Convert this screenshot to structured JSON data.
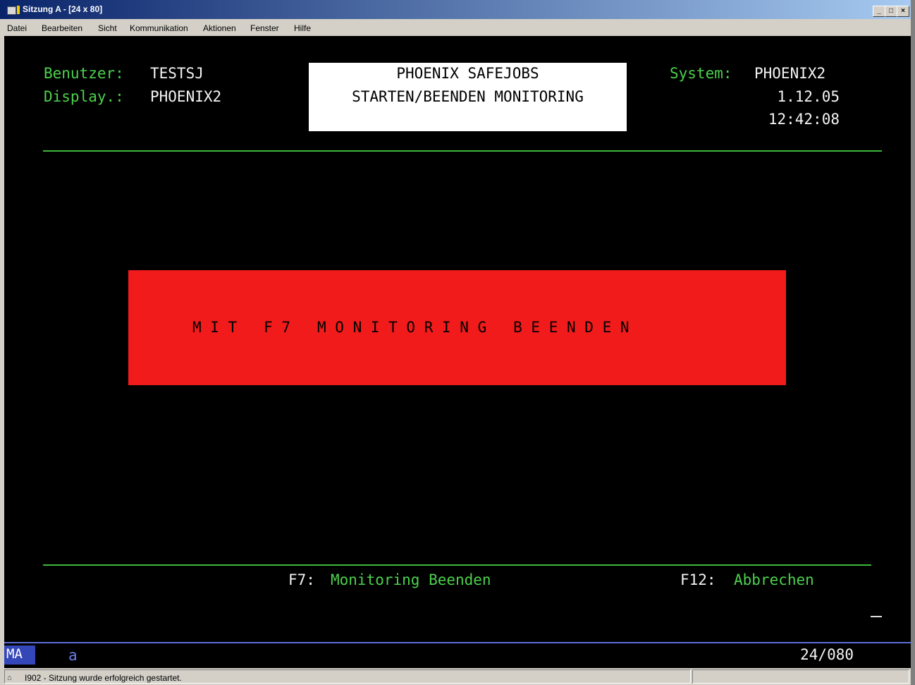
{
  "window": {
    "title": "Sitzung A - [24 x 80]",
    "controls": {
      "minimize": "_",
      "maximize": "□",
      "close": "×"
    }
  },
  "menu": [
    "Datei",
    "Bearbeiten",
    "Sicht",
    "Kommunikation",
    "Aktionen",
    "Fenster",
    "Hilfe"
  ],
  "screen": {
    "user_label": "Benutzer:",
    "user_value": "TESTSJ",
    "display_label": "Display.:",
    "display_value": "PHOENIX2",
    "title_line1": "PHOENIX SAFEJOBS",
    "title_line2": "STARTEN/BEENDEN MONITORING",
    "system_label": "System:",
    "system_value": "PHOENIX2",
    "date": "1.12.05",
    "time": "12:42:08",
    "message": "M I T   F 7   M O N I T O R I N G   B E E N D E N",
    "fkeys": [
      {
        "key": "F7:",
        "label": "Monitoring Beenden"
      },
      {
        "key": "F12:",
        "label": "Abbrechen"
      }
    ]
  },
  "oia": {
    "mode": "MA",
    "indicator": "a",
    "cursor_pos": "24/080"
  },
  "statusbar": {
    "message": "I902 - Sitzung wurde erfolgreich gestartet."
  },
  "colors": {
    "terminal_bg": "#000000",
    "field_green": "#4cd14c",
    "alert_red": "#f21b1b",
    "titlebar": "#0a246a"
  }
}
